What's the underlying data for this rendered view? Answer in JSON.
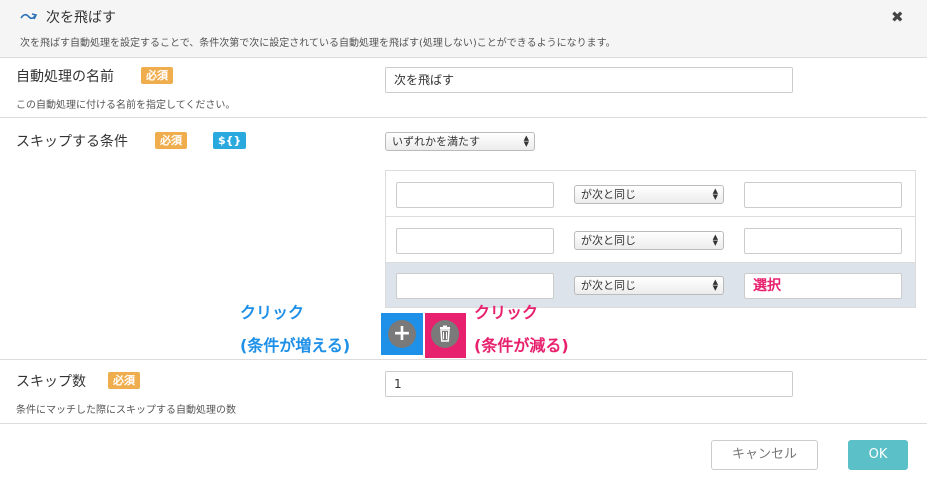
{
  "dialog": {
    "title": "次を飛ばす",
    "subtitle": "次を飛ばす自動処理を設定することで、条件次第で次に設定されている自動処理を飛ばす(処理しない)ことができるようになります。",
    "close_label": "✖"
  },
  "name_field": {
    "label": "自動処理の名前",
    "required_badge": "必須",
    "help": "この自動処理に付ける名前を指定してください。",
    "value": "次を飛ばす"
  },
  "skip_condition": {
    "label": "スキップする条件",
    "required_badge": "必須",
    "variable_badge": "${}",
    "mode_select": "いずれかを満たす",
    "rows": [
      {
        "left": "",
        "operator": "が次と同じ",
        "right": ""
      },
      {
        "left": "",
        "operator": "が次と同じ",
        "right": ""
      },
      {
        "left": "",
        "operator": "が次と同じ",
        "right": "選択"
      }
    ]
  },
  "annotations": {
    "add_line1": "クリック",
    "add_line2": "(条件が増える)",
    "delete_line1": "クリック",
    "delete_line2": "(条件が減る)"
  },
  "skip_count": {
    "label": "スキップ数",
    "required_badge": "必須",
    "help": "条件にマッチした際にスキップする自動処理の数",
    "value": "1"
  },
  "footer": {
    "cancel_label": "キャンセル",
    "ok_label": "OK"
  },
  "colors": {
    "required_badge": "#f0ad4e",
    "variable_badge": "#2aa9df",
    "annotation_blue": "#1e90e8",
    "annotation_pink": "#e8216e",
    "ok_button": "#5bc0c8",
    "selected_row": "#dce3ea"
  }
}
